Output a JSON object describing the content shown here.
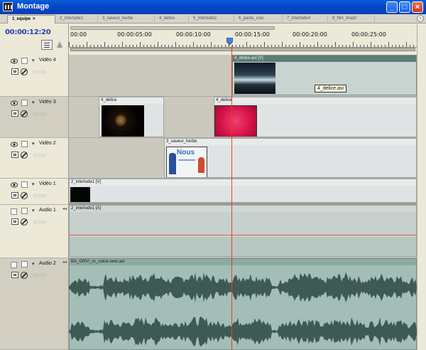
{
  "window": {
    "title": "Montage",
    "buttons": {
      "minimize": "_",
      "maximize": "□",
      "close": "×"
    },
    "accent_color": "#0a53d6"
  },
  "tabs": [
    {
      "label": "1_equipe",
      "active": true,
      "close": "×"
    },
    {
      "label": "2_interlude1"
    },
    {
      "label": "3_saveur_herbe"
    },
    {
      "label": "4_delice"
    },
    {
      "label": "5_interlude2"
    },
    {
      "label": "6_pasta_crac"
    },
    {
      "label": "7_interlude4"
    },
    {
      "label": "8_film_brazil"
    }
  ],
  "tabs_menu": "›",
  "timecode": "00:00:12:20",
  "ruler": {
    "labels": [
      "00:00",
      "00:00:05:00",
      "00:00:10:00",
      "00:00:15:00",
      "00:00:20:00",
      "00:00:25:00"
    ]
  },
  "tracks": {
    "video4": {
      "name": "Vidéo 4",
      "collapse": "▾",
      "nav": "◁ ◇ ▷"
    },
    "video3": {
      "name": "Vidéo 3",
      "collapse": "▾",
      "nav": "◁ ◇ ▷"
    },
    "video2": {
      "name": "Vidéo 2",
      "collapse": "▾",
      "nav": "◁ ◇ ▷"
    },
    "video1": {
      "name": "Vidéo 1",
      "collapse": "▾",
      "nav": "◁ ◇ ▷"
    },
    "audio1": {
      "name": "Audio 1",
      "collapse": "▾",
      "nav": "◁ ◇ ▷",
      "icon": "◂◂"
    },
    "audio2": {
      "name": "Audio 2",
      "collapse": "▾",
      "nav": "◁ ◇ ▷",
      "icon": "◂◂"
    }
  },
  "clips": {
    "v4_delice": "4_delice.avi [V]",
    "v3_delice_a": "4_delice",
    "v3_delice_b": "4_delice",
    "v2_saveur": "3_saveur_herbe",
    "v2_thumb_text": "Nous",
    "v1_interlude": "2_interlude1 [V]",
    "a1_interlude": "2_interlude1 [A]",
    "a2_voice": "BA_GRVI_cc_voice-over.avi"
  },
  "tooltip": "4_delice.avi",
  "icons": {
    "eye": "eye-icon",
    "lock": "lock-icon",
    "mute": "no-sync-icon",
    "mode": "display-mode-icon",
    "snap": "snap-icon",
    "marker": "marker-icon",
    "speaker": "speaker-icon"
  },
  "colors": {
    "playhead": "#e0431c",
    "audio_clip": "#b7ccc6",
    "waveform": "#3d5b54",
    "clip_red": "#d8154a"
  }
}
